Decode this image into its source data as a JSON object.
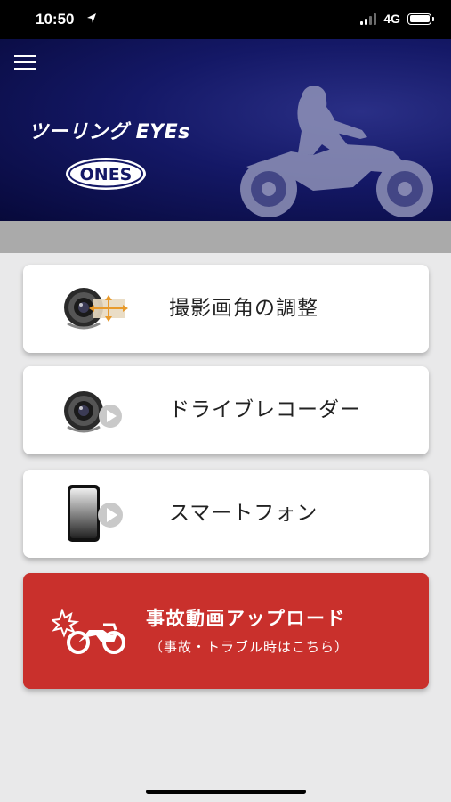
{
  "status_bar": {
    "time": "10:50",
    "network": "4G",
    "battery_level": 1.0,
    "icons": [
      "location-arrow-icon",
      "signal-icon",
      "battery-icon"
    ]
  },
  "header": {
    "menu_icon": "hamburger-menu-icon",
    "app_title": "ツーリング EYEs",
    "brand_logo_text": "ONES",
    "background_colors": [
      "#07093a",
      "#141866",
      "#2a2f86"
    ]
  },
  "menu": {
    "items": [
      {
        "label": "撮影画角の調整",
        "icon": "camera-angle-icon"
      },
      {
        "label": "ドライブレコーダー",
        "icon": "camera-play-icon"
      },
      {
        "label": "スマートフォン",
        "icon": "smartphone-play-icon"
      }
    ]
  },
  "accident": {
    "title": "事故動画アップロード",
    "subtitle": "（事故・トラブル時はこちら）",
    "icon": "motorcycle-crash-icon",
    "color": "#c9302c"
  }
}
